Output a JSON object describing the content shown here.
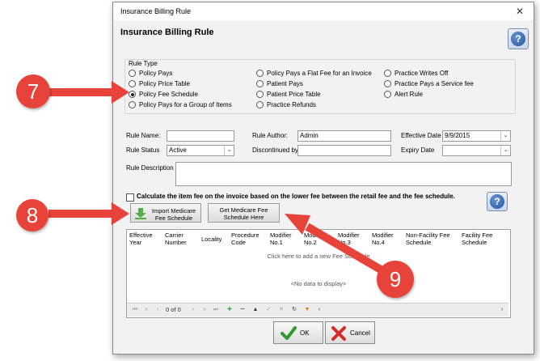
{
  "window": {
    "title": "Insurance Billing Rule",
    "close_glyph": "✕"
  },
  "header": {
    "title": "Insurance Billing Rule",
    "help_glyph": "?"
  },
  "rule_type": {
    "legend": "Rule Type",
    "options": [
      {
        "label": "Policy Pays",
        "selected": false
      },
      {
        "label": "Policy Price Table",
        "selected": false
      },
      {
        "label": "Policy Fee Schedule",
        "selected": true
      },
      {
        "label": "Policy Pays for a Group of Items",
        "selected": false
      },
      {
        "label": "Policy Pays a Flat Fee for an Invoice",
        "selected": false
      },
      {
        "label": "Patient Pays",
        "selected": false
      },
      {
        "label": "Patient Price Table",
        "selected": false
      },
      {
        "label": "Practice Refunds",
        "selected": false
      },
      {
        "label": "Practice Writes Off",
        "selected": false
      },
      {
        "label": "Practice Pays a Service fee",
        "selected": false
      },
      {
        "label": "Alert Rule",
        "selected": false
      }
    ]
  },
  "form": {
    "rule_name_label": "Rule Name:",
    "rule_name_value": "",
    "rule_status_label": "Rule Status",
    "rule_status_value": "Active",
    "rule_author_label": "Rule Author:",
    "rule_author_value": "Admin",
    "discontinued_label": "Discontinued by:",
    "discontinued_value": "",
    "effective_date_label": "Effective Date",
    "effective_date_value": "9/9/2015",
    "expiry_date_label": "Expiry Date",
    "expiry_date_value": "",
    "description_label": "Rule Description",
    "description_value": "",
    "calc_checkbox_label": "Calculate the item fee on the invoice based on the lower fee between the retail fee and the fee schedule.",
    "calc_checked": false
  },
  "buttons": {
    "import_medicare_line1": "Import Medicare",
    "import_medicare_line2": "Fee Schedule",
    "get_medicare_line1": "Get Medicare Fee",
    "get_medicare_line2": "Schedule Here",
    "ok": "OK",
    "cancel": "Cancel"
  },
  "grid": {
    "columns": [
      {
        "line1": "Effective",
        "line2": "Year"
      },
      {
        "line1": "Carrier",
        "line2": "Number"
      },
      {
        "line1": "Locality",
        "line2": ""
      },
      {
        "line1": "Procedure",
        "line2": "Code"
      },
      {
        "line1": "Modifier",
        "line2": "No.1"
      },
      {
        "line1": "Modifier",
        "line2": "No.2"
      },
      {
        "line1": "Modifier",
        "line2": "No.3"
      },
      {
        "line1": "Modifier",
        "line2": "No.4"
      },
      {
        "line1": "Non-Facility Fee",
        "line2": "Schedule"
      },
      {
        "line1": "Facility Fee",
        "line2": "Schedule"
      }
    ],
    "add_row_text": "Click here to add a new Fee Schedule",
    "empty_text": "<No data to display>",
    "page_indicator": "0 of 0"
  },
  "callouts": [
    {
      "label": "7"
    },
    {
      "label": "8"
    },
    {
      "label": "9"
    }
  ],
  "colors": {
    "callout": "#e8433a",
    "ok_check": "#2e9a2e",
    "cancel_x": "#d42a2a",
    "help": "#21519b"
  }
}
